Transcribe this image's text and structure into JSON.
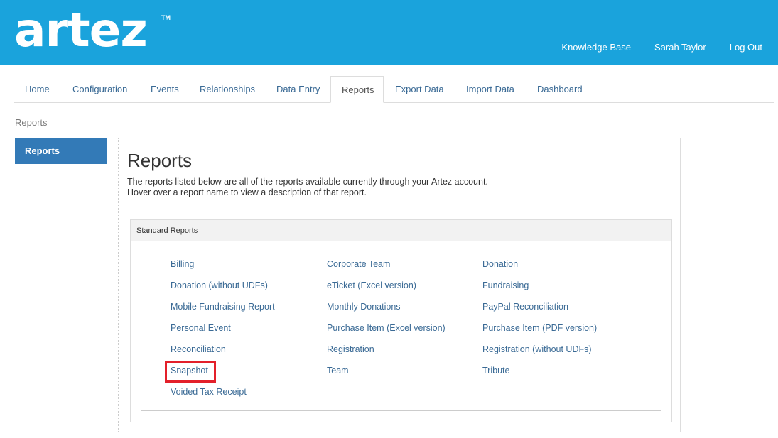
{
  "header": {
    "logo_text": "artez",
    "logo_tm": "TM",
    "links": [
      "Knowledge Base",
      "Sarah Taylor",
      "Log Out"
    ]
  },
  "tabs": [
    "Home",
    "Configuration",
    "Events",
    "Relationships",
    "Data Entry",
    "Reports",
    "Export Data",
    "Import Data",
    "Dashboard"
  ],
  "active_tab": "Reports",
  "breadcrumb": "Reports",
  "sidebar": {
    "items": [
      "Reports"
    ]
  },
  "main": {
    "title": "Reports",
    "description_line1": "The reports listed below are all of the reports available currently through your Artez account.",
    "description_line2": "Hover over a report name to view a description of that report."
  },
  "panel": {
    "title": "Standard Reports",
    "col1": [
      "Billing",
      "Donation (without UDFs)",
      "Mobile Fundraising Report",
      "Personal Event",
      "Reconciliation",
      "Snapshot",
      "Voided Tax Receipt"
    ],
    "col2": [
      "Corporate Team",
      "eTicket (Excel version)",
      "Monthly Donations",
      "Purchase Item (Excel version)",
      "Registration",
      "Team"
    ],
    "col3": [
      "Donation",
      "Fundraising",
      "PayPal Reconciliation",
      "Purchase Item (PDF version)",
      "Registration (without UDFs)",
      "Tribute"
    ]
  },
  "highlighted_report": "Snapshot",
  "colors": {
    "header": "#1aa3dc",
    "sidebar_active": "#337ab7",
    "link": "#3a6a95",
    "highlight": "#e3202a"
  }
}
